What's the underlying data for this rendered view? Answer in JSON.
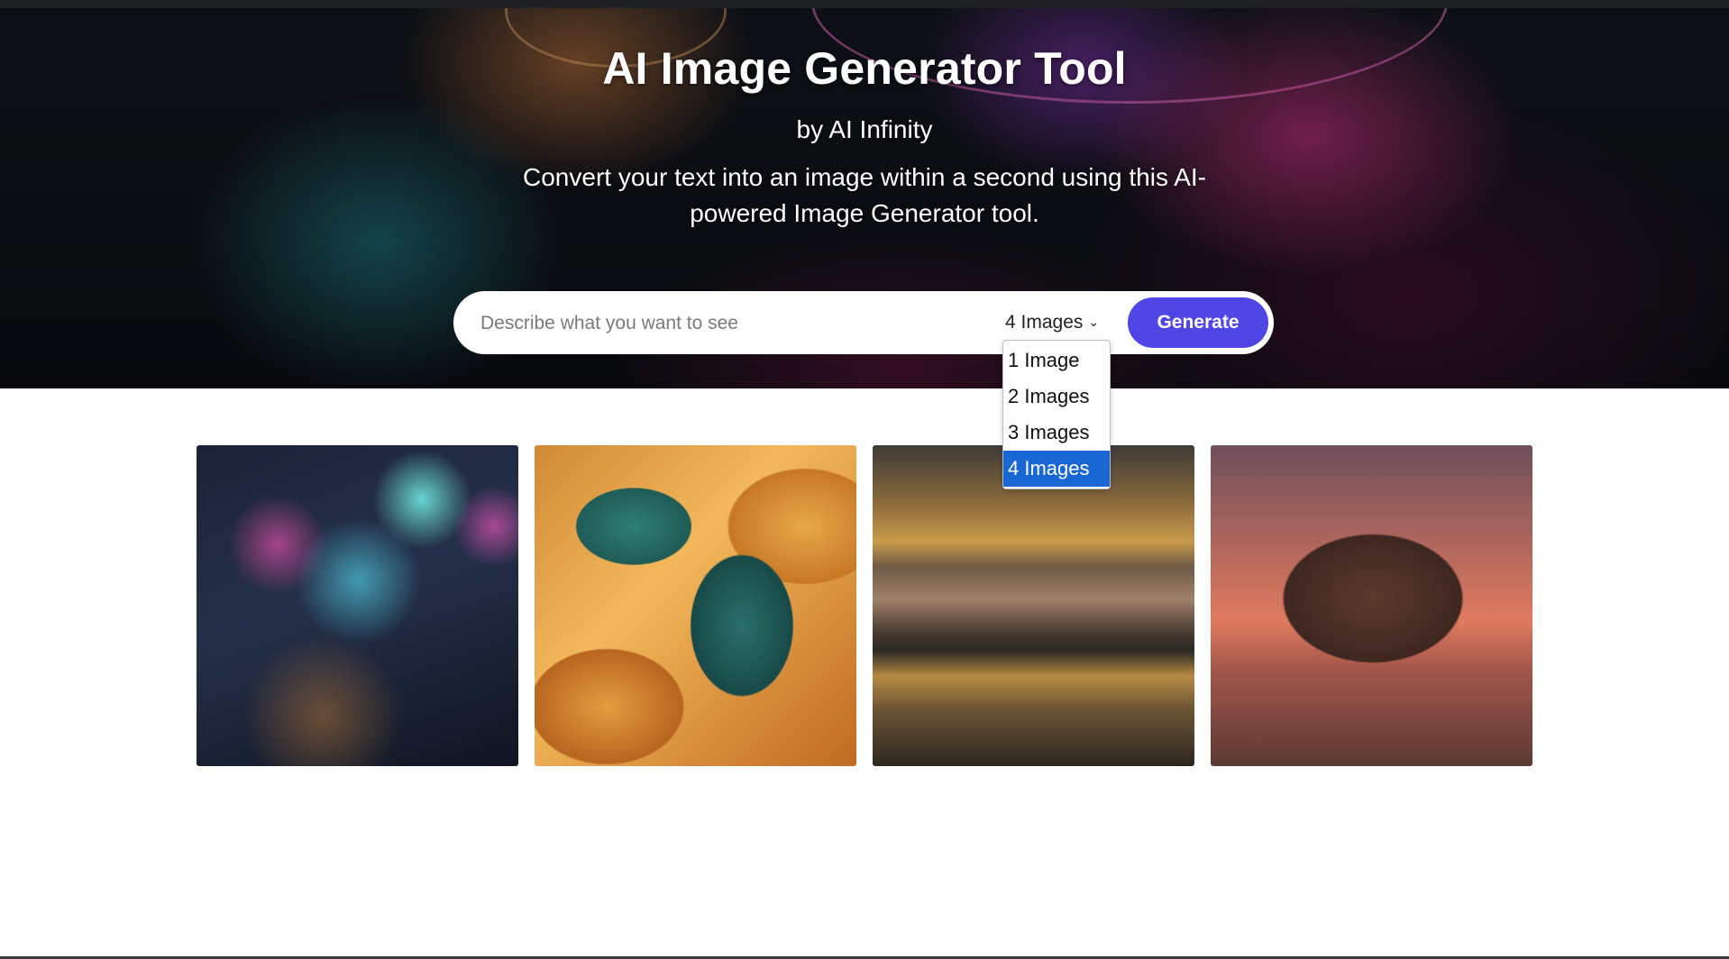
{
  "hero": {
    "title": "AI Image Generator Tool",
    "byline": "by AI Infinity",
    "description": "Convert your text into an image within a second using this AI-powered Image Generator tool."
  },
  "search": {
    "placeholder": "Describe what you want to see",
    "value": "",
    "count_selected": "4 Images",
    "generate_label": "Generate"
  },
  "dropdown": {
    "options": [
      "1 Image",
      "2 Images",
      "3 Images",
      "4 Images"
    ],
    "selected_index": 3
  },
  "gallery": {
    "images": [
      {
        "name": "city-overhead-night-image"
      },
      {
        "name": "tropical-leaves-image"
      },
      {
        "name": "harbor-town-reflection-image"
      },
      {
        "name": "sea-rock-arch-sunset-image"
      }
    ]
  },
  "colors": {
    "accent": "#4f46e5",
    "dropdown_selected": "#1967d2",
    "hero_text": "#ffffff"
  },
  "icons": {
    "count_chevron": "chevron-down-icon"
  }
}
